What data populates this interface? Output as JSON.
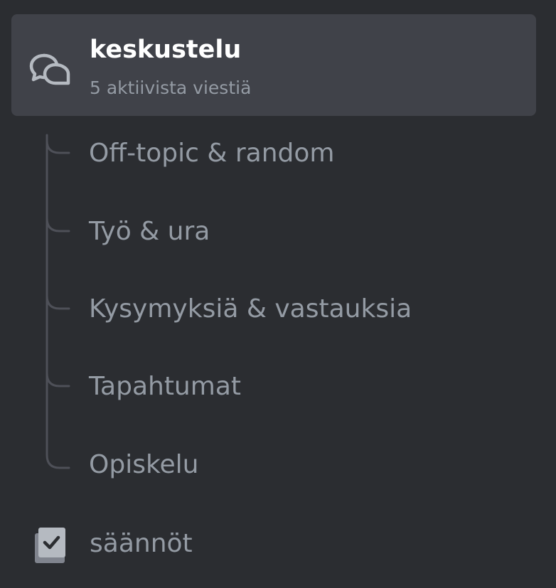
{
  "forum_channel": {
    "name": "keskustelu",
    "subtitle": "5 aktiivista viestiä",
    "icon": "forum-chat-bubbles-icon"
  },
  "threads": [
    {
      "label": "Off-topic & random"
    },
    {
      "label": "Työ & ura"
    },
    {
      "label": "Kysymyksiä & vastauksia"
    },
    {
      "label": "Tapahtumat"
    },
    {
      "label": "Opiskelu"
    }
  ],
  "rules_channel": {
    "name": "säännöt",
    "icon": "rules-checkbook-icon"
  },
  "colors": {
    "background": "#2b2d31",
    "selected": "#404249",
    "text_active": "#ffffff",
    "text_muted": "#949ba4",
    "tree_line": "#4e5058"
  }
}
